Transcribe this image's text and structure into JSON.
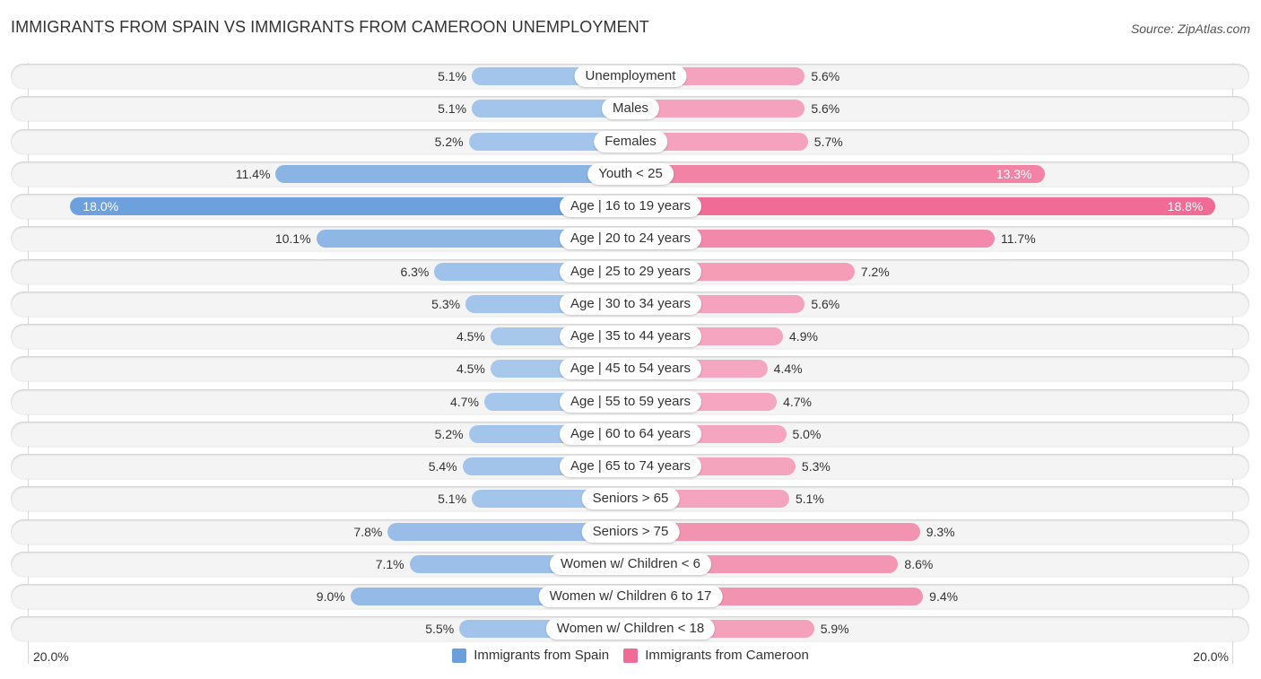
{
  "title": "IMMIGRANTS FROM SPAIN VS IMMIGRANTS FROM CAMEROON UNEMPLOYMENT",
  "source": "Source: ZipAtlas.com",
  "colors": {
    "spain": "#6a9fdc",
    "spain_light": "#a9c8ec",
    "cameroon": "#f06c96",
    "cameroon_light": "#f5a9c2"
  },
  "chart_data": {
    "type": "bar",
    "orientation": "horizontal-diverging",
    "title": "IMMIGRANTS FROM SPAIN VS IMMIGRANTS FROM CAMEROON UNEMPLOYMENT",
    "xlabel": "",
    "ylabel": "",
    "xlim": [
      -20,
      20
    ],
    "axis_labels": {
      "left": "20.0%",
      "right": "20.0%"
    },
    "legend_position": "bottom",
    "categories": [
      "Unemployment",
      "Males",
      "Females",
      "Youth < 25",
      "Age | 16 to 19 years",
      "Age | 20 to 24 years",
      "Age | 25 to 29 years",
      "Age | 30 to 34 years",
      "Age | 35 to 44 years",
      "Age | 45 to 54 years",
      "Age | 55 to 59 years",
      "Age | 60 to 64 years",
      "Age | 65 to 74 years",
      "Seniors > 65",
      "Seniors > 75",
      "Women w/ Children < 6",
      "Women w/ Children 6 to 17",
      "Women w/ Children < 18"
    ],
    "series": [
      {
        "name": "Immigrants from Spain",
        "side": "left",
        "values": [
          5.1,
          5.1,
          5.2,
          11.4,
          18.0,
          10.1,
          6.3,
          5.3,
          4.5,
          4.5,
          4.7,
          5.2,
          5.4,
          5.1,
          7.8,
          7.1,
          9.0,
          5.5
        ]
      },
      {
        "name": "Immigrants from Cameroon",
        "side": "right",
        "values": [
          5.6,
          5.6,
          5.7,
          13.3,
          18.8,
          11.7,
          7.2,
          5.6,
          4.9,
          4.4,
          4.7,
          5.0,
          5.3,
          5.1,
          9.3,
          8.6,
          9.4,
          5.9
        ]
      }
    ],
    "value_suffix": "%"
  },
  "legend": {
    "items": [
      "Immigrants from Spain",
      "Immigrants from Cameroon"
    ]
  }
}
